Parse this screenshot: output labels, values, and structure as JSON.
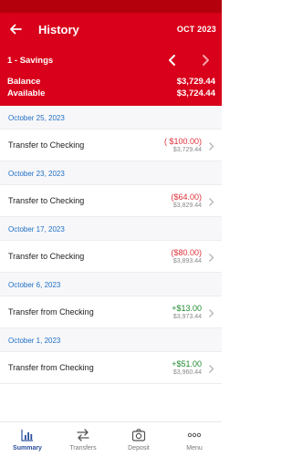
{
  "header": {
    "title": "History",
    "month": "OCT 2023",
    "account_name": "1 - Savings",
    "balance_label": "Balance",
    "balance_value": "$3,729.44",
    "available_label": "Available",
    "available_value": "$3,724.44",
    "back_icon": "back-arrow-icon",
    "prev_icon": "chevron-left-icon",
    "next_icon": "chevron-right-icon"
  },
  "groups": [
    {
      "date": "October 25, 2023",
      "items": [
        {
          "desc": "Transfer to Checking",
          "amount": "( $100.00)",
          "balance": "$3,729.44",
          "type": "debit"
        }
      ]
    },
    {
      "date": "October 23, 2023",
      "items": [
        {
          "desc": "Transfer to Checking",
          "amount": "($64.00)",
          "balance": "$3,829.44",
          "type": "debit"
        }
      ]
    },
    {
      "date": "October 17, 2023",
      "items": [
        {
          "desc": "Transfer to Checking",
          "amount": "($80.00)",
          "balance": "$3,893.44",
          "type": "debit"
        }
      ]
    },
    {
      "date": "October 6, 2023",
      "items": [
        {
          "desc": "Transfer from Checking",
          "amount": "+$13.00",
          "balance": "$3,973.44",
          "type": "credit"
        }
      ]
    },
    {
      "date": "October 1, 2023",
      "items": [
        {
          "desc": "Transfer from Checking",
          "amount": "+$51.00",
          "balance": "$3,960.44",
          "type": "credit"
        }
      ]
    }
  ],
  "tabs": [
    {
      "label": "Summary",
      "icon": "bar-chart-icon",
      "active": true
    },
    {
      "label": "Transfers",
      "icon": "transfer-arrows-icon",
      "active": false
    },
    {
      "label": "Deposit",
      "icon": "camera-icon",
      "active": false
    },
    {
      "label": "Menu",
      "icon": "more-dots-icon",
      "active": false
    }
  ],
  "colors": {
    "brand_red": "#d8001a",
    "date_blue": "#1f6fc5",
    "debit": "#e0313b",
    "credit": "#1e8a2f",
    "tab_active": "#2a4f9e"
  }
}
